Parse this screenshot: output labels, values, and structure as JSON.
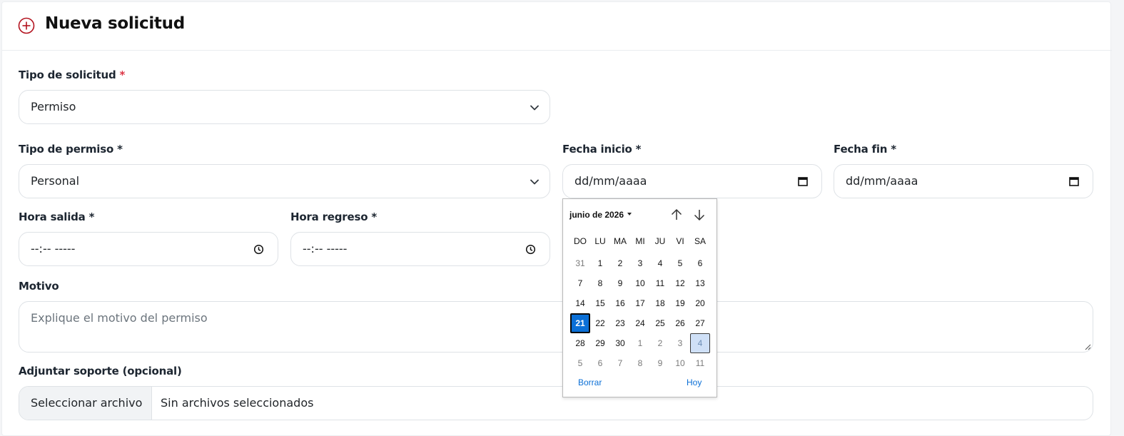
{
  "header": {
    "title": "Nueva solicitud",
    "icon": "plus-circle-icon",
    "accent_color": "#b3121e"
  },
  "form": {
    "tipo_solicitud": {
      "label": "Tipo de solicitud",
      "required_mark": "*",
      "value": "Permiso"
    },
    "tipo_permiso": {
      "label": "Tipo de permiso *",
      "value": "Personal"
    },
    "fecha_inicio": {
      "label": "Fecha inicio *",
      "placeholder": "dd/mm/aaaa"
    },
    "fecha_fin": {
      "label": "Fecha fin *",
      "placeholder": "dd/mm/aaaa"
    },
    "hora_salida": {
      "label": "Hora salida *",
      "placeholder": "--:-- -----"
    },
    "hora_regreso": {
      "label": "Hora regreso *",
      "placeholder": "--:-- -----"
    },
    "motivo": {
      "label": "Motivo",
      "placeholder": "Explique el motivo del permiso"
    },
    "adjunto": {
      "label": "Adjuntar soporte (opcional)",
      "button_label": "Seleccionar archivo",
      "status": "Sin archivos seleccionados"
    }
  },
  "datepicker": {
    "month_label": "junio de 2026",
    "weekdays": [
      "DO",
      "LU",
      "MA",
      "MI",
      "JU",
      "VI",
      "SA"
    ],
    "weeks": [
      [
        {
          "d": "31",
          "dim": true
        },
        {
          "d": "1"
        },
        {
          "d": "2"
        },
        {
          "d": "3"
        },
        {
          "d": "4"
        },
        {
          "d": "5"
        },
        {
          "d": "6"
        }
      ],
      [
        {
          "d": "7"
        },
        {
          "d": "8"
        },
        {
          "d": "9"
        },
        {
          "d": "10"
        },
        {
          "d": "11"
        },
        {
          "d": "12"
        },
        {
          "d": "13"
        }
      ],
      [
        {
          "d": "14"
        },
        {
          "d": "15"
        },
        {
          "d": "16"
        },
        {
          "d": "17"
        },
        {
          "d": "18"
        },
        {
          "d": "19"
        },
        {
          "d": "20"
        }
      ],
      [
        {
          "d": "21",
          "selected": true
        },
        {
          "d": "22"
        },
        {
          "d": "23"
        },
        {
          "d": "24"
        },
        {
          "d": "25"
        },
        {
          "d": "26"
        },
        {
          "d": "27"
        }
      ],
      [
        {
          "d": "28"
        },
        {
          "d": "29"
        },
        {
          "d": "30"
        },
        {
          "d": "1",
          "dim": true
        },
        {
          "d": "2",
          "dim": true
        },
        {
          "d": "3",
          "dim": true
        },
        {
          "d": "4",
          "dim": true,
          "highlighted": true
        }
      ],
      [
        {
          "d": "5",
          "dim": true
        },
        {
          "d": "6",
          "dim": true
        },
        {
          "d": "7",
          "dim": true
        },
        {
          "d": "8",
          "dim": true
        },
        {
          "d": "9",
          "dim": true
        },
        {
          "d": "10",
          "dim": true
        },
        {
          "d": "11",
          "dim": true
        }
      ]
    ],
    "clear_label": "Borrar",
    "today_label": "Hoy",
    "selected_color": "#0b6fd6"
  }
}
